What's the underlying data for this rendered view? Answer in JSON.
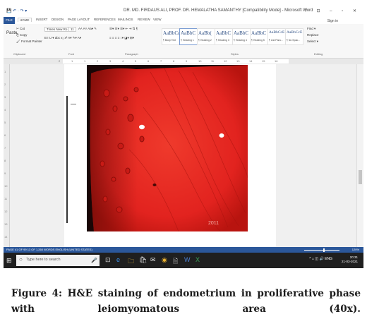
{
  "window": {
    "title": "DR. MD. FIRDAUS ALI, PROF. DR. HEMALATHA SAMANTHY [Compatibility Mode] - Microsoft Word",
    "quick_access": "💾 ↶ · ↷ ▾",
    "controls": "?  ⊡  –  ▫  ✕",
    "sign_in": "Sign in"
  },
  "tabs": [
    {
      "label": "FILE"
    },
    {
      "label": "HOME"
    },
    {
      "label": "INSERT"
    },
    {
      "label": "DESIGN"
    },
    {
      "label": "PAGE LAYOUT"
    },
    {
      "label": "REFERENCES"
    },
    {
      "label": "MAILINGS"
    },
    {
      "label": "REVIEW"
    },
    {
      "label": "VIEW"
    }
  ],
  "ribbon": {
    "clipboard": {
      "paste": "Paste",
      "cut": "✂ Cut",
      "copy": "⎘ Copy",
      "format_painter": "🖌 Format Painter",
      "group": "Clipboard"
    },
    "font": {
      "name": "Times New Ro",
      "size": "11",
      "tools": "A˄ A˅ Aa▾ ✎",
      "format_buttons": "B  I  U ▾ abc x₂ x²  A▾ ✎▾ A▾",
      "group": "Font"
    },
    "paragraph": {
      "row1": "☰▾ ☰▾ ☰▾ ⇤ ⇥ ⇅ ¶",
      "row2": "≡ ≡ ≡ ≡  ↕▾ ◪▾ ⊞▾",
      "group": "Paragraph"
    },
    "styles": {
      "items": [
        {
          "sample": "AaBbCc",
          "name": "¶ Body Text"
        },
        {
          "sample": "AaBbC",
          "name": "¶ Heading 1"
        },
        {
          "sample": "AaBb(",
          "name": "¶ Heading 2"
        },
        {
          "sample": "AaBbC",
          "name": "¶ Heading 3"
        },
        {
          "sample": "AaBbC",
          "name": "¶ Heading 4"
        },
        {
          "sample": "AaBbC",
          "name": "¶ Heading 5"
        },
        {
          "sample": "AaBbCcE",
          "name": "¶ List Para..."
        },
        {
          "sample": "AaBbCcE",
          "name": "¶ No Spac..."
        }
      ],
      "group": "Styles"
    },
    "editing": {
      "find": "Find ▾",
      "replace": "Replace",
      "select": "Select ▾",
      "group": "Editing"
    }
  },
  "ruler": {
    "marks": [
      "2",
      "1",
      "1",
      "2",
      "3",
      "4",
      "5",
      "6",
      "7",
      "8",
      "9",
      "10",
      "11",
      "12",
      "13",
      "14",
      "15",
      "16"
    ]
  },
  "vruler": {
    "marks": [
      "1",
      "2",
      "3",
      "4",
      "5",
      "6",
      "7",
      "8",
      "9",
      "10",
      "11",
      "12",
      "13",
      "14"
    ]
  },
  "slide": {
    "timestamp": "2011"
  },
  "status": {
    "left": "PAGE 41 OF 99    13 OF 1,260 WORDS    ENGLISH (UNITED STATES)",
    "zoom": "120%"
  },
  "taskbar": {
    "start": "⊞",
    "search_placeholder": "Type here to search",
    "icons": [
      "🎤",
      "⊡",
      "e",
      "🗀",
      "🛍",
      "✉",
      "◉",
      "🗎",
      "W",
      "X"
    ],
    "tray": "^ ⌂ ◫ 🔊 ENG",
    "time": "20:31",
    "date": "21-03-2021"
  },
  "caption": "Figure 4: H&E staining of endometrium in proliferative phase with leiomyomatous area (40x).",
  "colors": {
    "accent": "#2b579a",
    "tissue": "#e2231f",
    "tissue_dark": "#1a0606"
  }
}
